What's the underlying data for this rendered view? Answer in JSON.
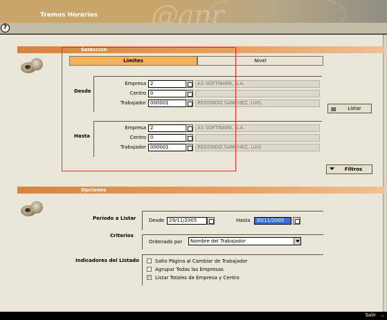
{
  "window": {
    "title": "Tramos Horarios",
    "logo_text": "@anr"
  },
  "toolbar": {
    "help_label": "?"
  },
  "seleccion": {
    "section_title": "Selección",
    "tabs": [
      {
        "label": "Límites",
        "active": true
      },
      {
        "label": "Nivel",
        "active": false
      }
    ],
    "desde": {
      "label": "Desde",
      "empresa": {
        "label": "Empresa",
        "value": "2",
        "desc": "A3 SOFTWARE, S.A."
      },
      "centro": {
        "label": "Centro",
        "value": "0",
        "desc": ""
      },
      "trabajador": {
        "label": "Trabajador",
        "value": "000001",
        "desc": "REDONDO SANCHEZ, LUIS"
      }
    },
    "hasta": {
      "label": "Hasta",
      "empresa": {
        "label": "Empresa",
        "value": "2",
        "desc": "A3 SOFTWARE, S.A."
      },
      "centro": {
        "label": "Centro",
        "value": "0",
        "desc": ""
      },
      "trabajador": {
        "label": "Trabajador",
        "value": "000001",
        "desc": "REDONDO SANCHEZ, LUIS"
      }
    },
    "listar_label": "Listar",
    "filtros_label": "Filtros"
  },
  "opciones": {
    "section_title": "Opciones",
    "periodo": {
      "label": "Período a Listar",
      "desde_label": "Desde",
      "desde_value": "29/11/2005",
      "hasta_label": "Hasta",
      "hasta_value": "30/11/2005"
    },
    "criterios": {
      "label": "Criterios",
      "ordenado_label": "Ordenado por",
      "ordenado_value": "Nombre del Trabajador"
    },
    "indicadores": {
      "label": "Indicadores del Listado",
      "items": [
        {
          "label": "Salto Página al Cambiar de Trabajador",
          "checked": false,
          "mark": ""
        },
        {
          "label": "Agrupar Todas las Empresas",
          "checked": false,
          "mark": ""
        },
        {
          "label": "Listar Totales de Empresa y Centro",
          "checked": true,
          "mark": "✓"
        }
      ]
    }
  },
  "statusbar": {
    "exit_label": "Salir",
    "exit_icon": "exit-arrow-icon"
  },
  "colors": {
    "section_orange": "#e08a44",
    "active_tab": "#f2b35c",
    "panel_bg": "#ebe7d8",
    "highlight": "#ff2020"
  }
}
